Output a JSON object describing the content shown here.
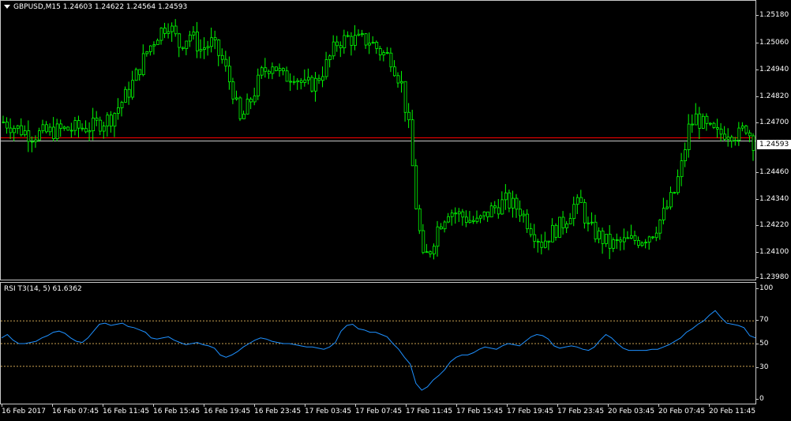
{
  "main_chart": {
    "symbol_line": "GBPUSD,M15  1.24603 1.24622 1.24564 1.24593",
    "current_price": "1.24593",
    "price_ticks": [
      "1.25180",
      "1.25060",
      "1.24940",
      "1.24820",
      "1.24700",
      "1.24460",
      "1.24340",
      "1.24220",
      "1.24100",
      "1.23980"
    ],
    "candle_color": "#00ff00",
    "red_line_color": "#ff0000"
  },
  "rsi_panel": {
    "title": "RSI T3(14, 5) 61.6362",
    "levels": [
      "100",
      "70",
      "50",
      "30",
      "0"
    ],
    "line_color": "#1e90ff",
    "level_color": "#c8a050"
  },
  "time_axis": [
    "16 Feb 2017",
    "16 Feb 07:45",
    "16 Feb 11:45",
    "16 Feb 15:45",
    "16 Feb 19:45",
    "16 Feb 23:45",
    "17 Feb 03:45",
    "17 Feb 07:45",
    "17 Feb 11:45",
    "17 Feb 15:45",
    "17 Feb 19:45",
    "17 Feb 23:45",
    "20 Feb 03:45",
    "20 Feb 07:45",
    "20 Feb 11:45"
  ],
  "chart_data": [
    {
      "type": "candlestick",
      "title": "GBPUSD,M15  1.24603 1.24622 1.24564 1.24593",
      "ylim": [
        1.2397,
        1.2522
      ],
      "close_path": [
        [
          0,
          1.2468
        ],
        [
          8,
          1.2462
        ],
        [
          15,
          1.2464
        ],
        [
          25,
          1.2466
        ],
        [
          30,
          1.247
        ],
        [
          35,
          1.2482
        ],
        [
          40,
          1.25
        ],
        [
          43,
          1.2508
        ],
        [
          46,
          1.2513
        ],
        [
          49,
          1.2503
        ],
        [
          52,
          1.2508
        ],
        [
          55,
          1.2501
        ],
        [
          58,
          1.2504
        ],
        [
          61,
          1.2496
        ],
        [
          64,
          1.2482
        ],
        [
          66,
          1.2468
        ],
        [
          69,
          1.2478
        ],
        [
          72,
          1.249
        ],
        [
          75,
          1.2495
        ],
        [
          78,
          1.2488
        ],
        [
          81,
          1.249
        ],
        [
          84,
          1.2484
        ],
        [
          87,
          1.2486
        ],
        [
          90,
          1.2494
        ],
        [
          93,
          1.2504
        ],
        [
          96,
          1.2506
        ],
        [
          99,
          1.2505
        ],
        [
          102,
          1.2505
        ],
        [
          105,
          1.25
        ],
        [
          108,
          1.2497
        ],
        [
          111,
          1.2485
        ],
        [
          113,
          1.2465
        ],
        [
          115,
          1.243
        ],
        [
          117,
          1.2405
        ],
        [
          119,
          1.241
        ],
        [
          121,
          1.242
        ],
        [
          124,
          1.2428
        ],
        [
          128,
          1.2425
        ],
        [
          132,
          1.2422
        ],
        [
          136,
          1.2428
        ],
        [
          140,
          1.2432
        ],
        [
          144,
          1.2428
        ],
        [
          147,
          1.242
        ],
        [
          150,
          1.2413
        ],
        [
          153,
          1.2418
        ],
        [
          156,
          1.2422
        ],
        [
          159,
          1.243
        ],
        [
          161,
          1.243
        ],
        [
          163,
          1.242
        ],
        [
          166,
          1.2416
        ],
        [
          169,
          1.2412
        ],
        [
          172,
          1.2413
        ],
        [
          175,
          1.2414
        ],
        [
          178,
          1.2415
        ],
        [
          181,
          1.2418
        ],
        [
          184,
          1.2426
        ],
        [
          187,
          1.2436
        ],
        [
          189,
          1.2448
        ],
        [
          191,
          1.2465
        ],
        [
          193,
          1.247
        ],
        [
          196,
          1.2465
        ],
        [
          199,
          1.2462
        ],
        [
          202,
          1.2464
        ],
        [
          205,
          1.2462
        ],
        [
          207,
          1.2466
        ],
        [
          209,
          1.2459
        ]
      ],
      "candle_count": 210
    },
    {
      "type": "line",
      "title": "RSI T3(14, 5) 61.6362",
      "ylim": [
        0,
        100
      ],
      "levels": [
        30,
        50,
        70
      ],
      "series": [
        {
          "name": "RSI T3(14, 5)",
          "values": [
            55,
            58,
            53,
            50,
            50,
            51,
            52,
            55,
            57,
            60,
            61,
            59,
            55,
            52,
            51,
            55,
            61,
            67,
            68,
            66,
            67,
            68,
            65,
            64,
            62,
            60,
            55,
            54,
            55,
            56,
            53,
            51,
            49,
            50,
            51,
            49,
            48,
            46,
            40,
            38,
            40,
            43,
            47,
            50,
            53,
            55,
            54,
            52,
            51,
            50,
            50,
            49,
            48,
            47,
            47,
            46,
            45,
            47,
            51,
            61,
            66,
            67,
            63,
            62,
            60,
            60,
            58,
            56,
            50,
            45,
            38,
            32,
            15,
            9,
            12,
            18,
            22,
            27,
            34,
            38,
            40,
            40,
            42,
            45,
            47,
            46,
            45,
            48,
            50,
            49,
            48,
            52,
            56,
            58,
            57,
            54,
            48,
            46,
            47,
            48,
            47,
            45,
            44,
            47,
            53,
            58,
            55,
            50,
            46,
            44,
            44,
            44,
            44,
            45,
            45,
            47,
            49,
            52,
            55,
            60,
            63,
            67,
            70,
            75,
            79,
            73,
            68,
            67,
            66,
            64,
            57,
            55
          ]
        }
      ]
    }
  ]
}
